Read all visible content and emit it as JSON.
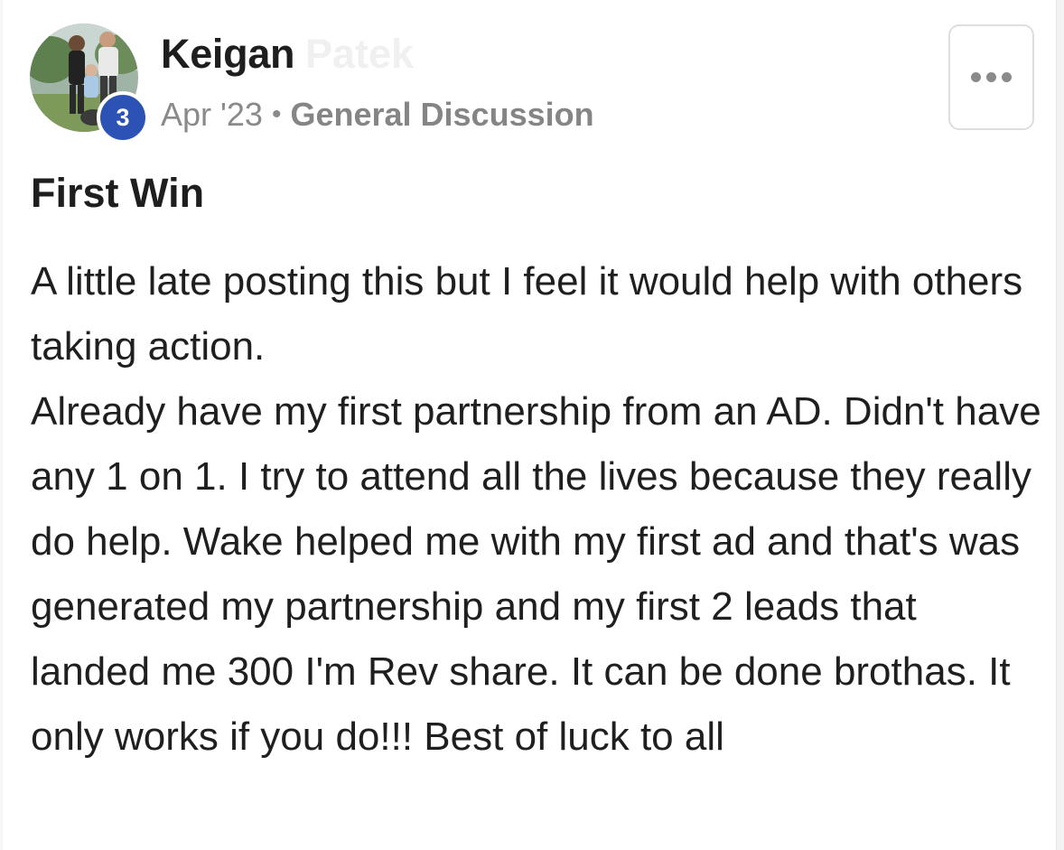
{
  "post": {
    "author": {
      "first_name": "Keigan",
      "surname_faint": "Patek",
      "level": "3",
      "avatar_icon": "user-avatar-photo"
    },
    "date": "Apr '23",
    "separator": "•",
    "category": "General Discussion",
    "title": "First Win",
    "body": [
      "A little late posting this but I feel it would help with others taking action.",
      "Already have my first partnership from an AD. Didn't have any 1 on 1. I try to attend all the lives because they really do help. Wake helped me with my first ad and that's was generated my partnership and my first 2 leads that landed me 300 I'm Rev share. It can be done brothas. It only works if you do!!! Best of luck to all"
    ],
    "more_button_icon": "more-horizontal-icon"
  },
  "colors": {
    "level_badge": "#2b52b4",
    "meta_text": "#8a8a8a",
    "text": "#1f1f1f"
  }
}
